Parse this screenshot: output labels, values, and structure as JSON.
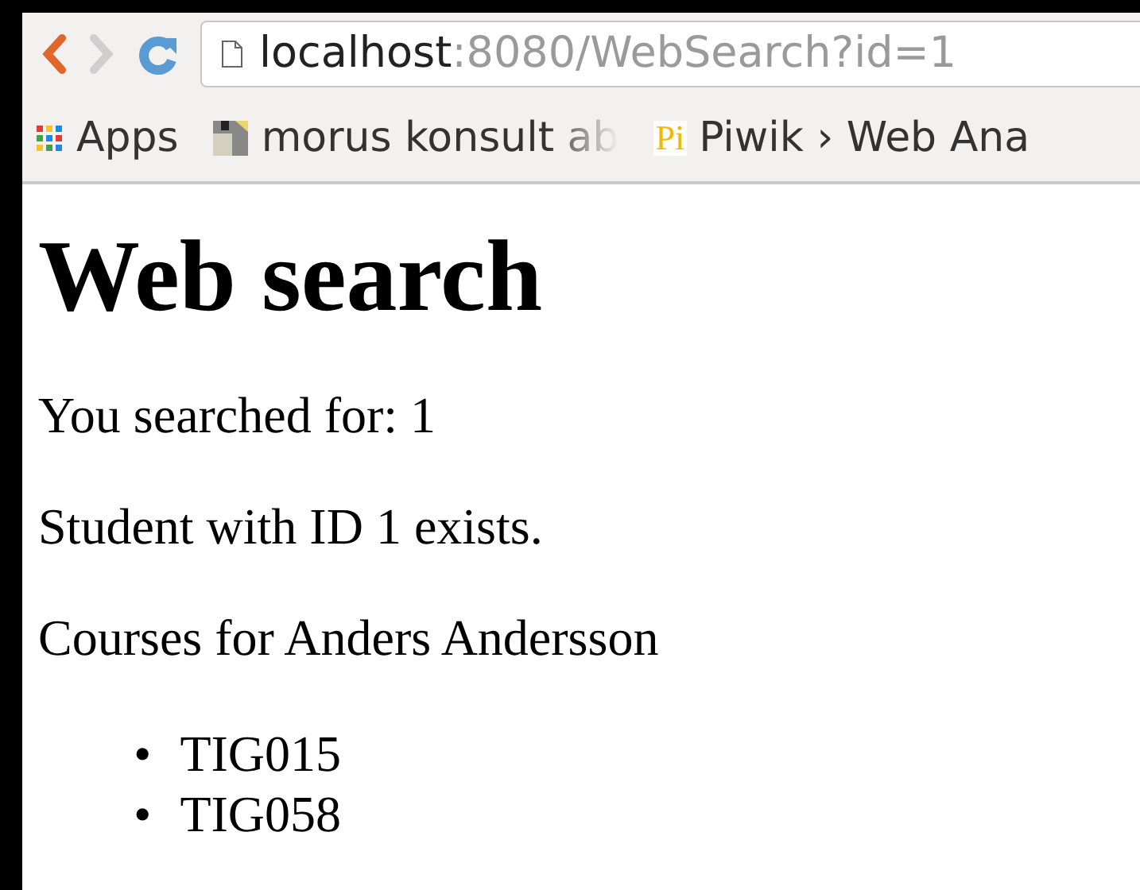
{
  "address_bar": {
    "host": "localhost",
    "rest": ":8080/WebSearch?id=1"
  },
  "bookmarks": [
    {
      "kind": "apps",
      "label": "Apps"
    },
    {
      "kind": "page",
      "label": "morus konsult ab"
    },
    {
      "kind": "logo",
      "logo_text": "Pi",
      "label": "Piwik › Web Ana"
    }
  ],
  "page": {
    "heading": "Web search",
    "paragraphs": [
      "You searched for: 1",
      "Student with ID 1 exists.",
      "Courses for Anders Andersson"
    ],
    "courses": [
      {
        "bullet": "•",
        "code": "TIG015"
      },
      {
        "bullet": "•",
        "code": "TIG058"
      }
    ]
  }
}
